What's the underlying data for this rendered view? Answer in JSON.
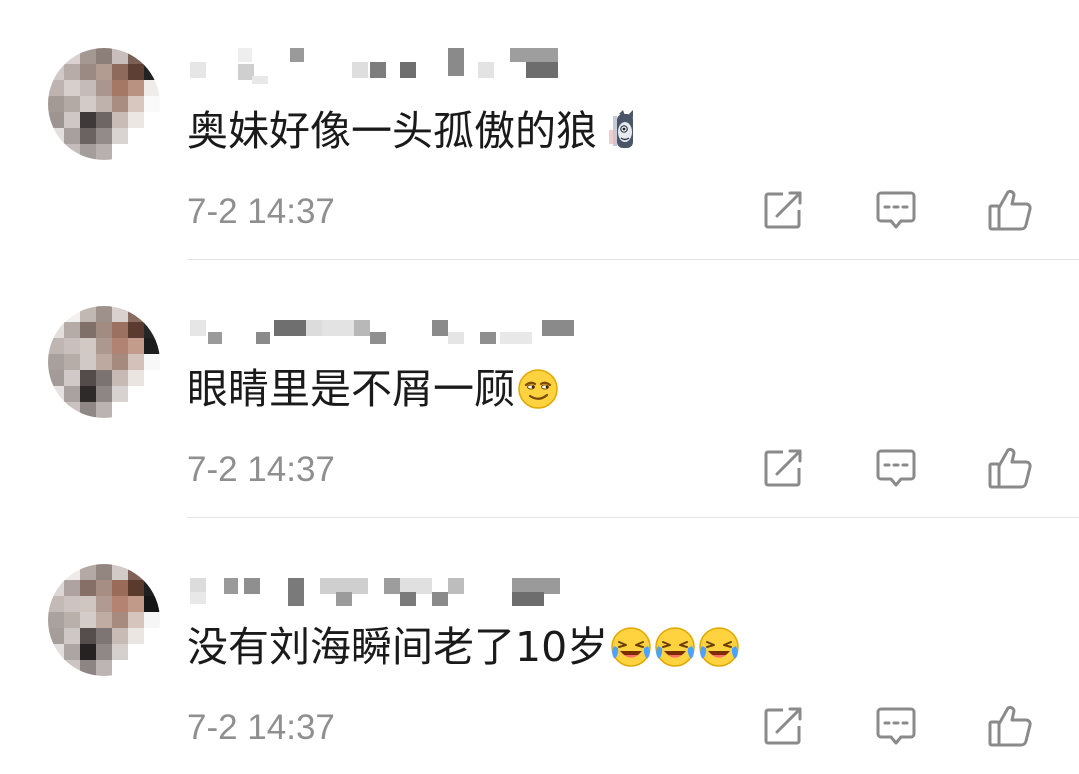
{
  "comments": [
    {
      "text": "奥妹好像一头孤傲的狼",
      "emojis": [
        "wolf-emoji"
      ],
      "timestamp": "7-2 14:37"
    },
    {
      "text": "眼睛里是不屑一顾",
      "emojis": [
        "smirk-emoji"
      ],
      "timestamp": "7-2 14:37"
    },
    {
      "text": "没有刘海瞬间老了10岁",
      "emojis": [
        "crying-laugh-emoji",
        "crying-laugh-emoji",
        "crying-laugh-emoji"
      ],
      "timestamp": "7-2 14:37"
    }
  ],
  "actions": {
    "repost_icon": "repost-icon",
    "reply_icon": "comment-icon",
    "like_icon": "thumbs-up-icon"
  },
  "colors": {
    "text": "#1a1a1a",
    "meta": "#8f8f8f",
    "icon": "#8a8a8a",
    "divider": "#e3e3e3"
  }
}
